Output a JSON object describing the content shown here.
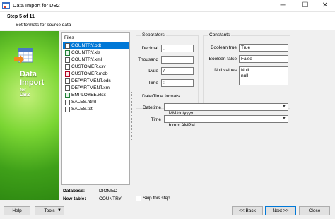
{
  "window": {
    "title": "Data Import for DB2",
    "minimize": "─",
    "maximize": "☐",
    "close": "✕"
  },
  "header": {
    "step": "Step 5 of 11",
    "subtitle": "Set formats for source data"
  },
  "sidebar": {
    "line1": "Data",
    "line2": "Import",
    "line3": "for",
    "line4": "DB2"
  },
  "files": {
    "label": "Files",
    "items": [
      {
        "name": "COUNTRY.odt",
        "icon": "odt-file-icon",
        "selected": true
      },
      {
        "name": "COUNTRY.xls",
        "icon": "excel-file-icon"
      },
      {
        "name": "COUNTRY.xml",
        "icon": "xml-file-icon"
      },
      {
        "name": "CUSTOMER.csv",
        "icon": "csv-file-icon"
      },
      {
        "name": "CUSTOMER.mdb",
        "icon": "access-file-icon"
      },
      {
        "name": "DEPARTMENT.ods",
        "icon": "ods-file-icon"
      },
      {
        "name": "DEPARTMENT.xml",
        "icon": "xml-file-icon"
      },
      {
        "name": "EMPLOYEE.xlsx",
        "icon": "excel-file-icon"
      },
      {
        "name": "SALES.html",
        "icon": "html-file-icon"
      },
      {
        "name": "SALES.txt",
        "icon": "txt-file-icon"
      }
    ]
  },
  "separators": {
    "title": "Separators",
    "decimal_label": "Decimal",
    "decimal_value": ",",
    "thousand_label": "Thousand",
    "thousand_value": " ",
    "date_label": "Date",
    "date_value": "/",
    "time_label": "Time",
    "time_value": ":"
  },
  "constants": {
    "title": "Constants",
    "bool_true_label": "Boolean true",
    "bool_true_value": "True",
    "bool_false_label": "Boolean false",
    "bool_false_value": "False",
    "null_label": "Null values",
    "null_line1": "Null",
    "null_line2": "null"
  },
  "datetime": {
    "title": "Date/Time formats",
    "datetime_label": "Datetime",
    "datetime_value": "MM/dd/yyyy",
    "time_label": "Time",
    "time_value": "h:mm AMPM"
  },
  "info": {
    "database_label": "Database:",
    "database_value": "DIOMED",
    "table_label": "New table:",
    "table_value": "COUNTRY",
    "skip_label": "Skip this step"
  },
  "buttons": {
    "help": "Help",
    "tools": "Tools",
    "back": "<< Back",
    "next": "Next >>",
    "close": "Close"
  },
  "colors": {
    "selection": "#0078d7",
    "sidebar_green": "#5ec22a"
  }
}
